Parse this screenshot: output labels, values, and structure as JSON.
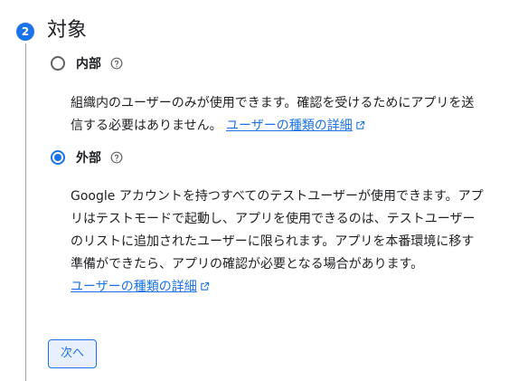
{
  "step": {
    "number": "2",
    "title": "対象"
  },
  "options": [
    {
      "label": "内部",
      "checked": false,
      "description": "組織内のユーザーのみが使用できます。確認を受けるためにアプリを送信する必要はありません。",
      "link_text": "ユーザーの種類の詳細"
    },
    {
      "label": "外部",
      "checked": true,
      "description": "Google アカウントを持つすべてのテストユーザーが使用できます。アプリはテストモードで起動し、アプリを使用できるのは、テストユーザーのリストに追加されたユーザーに限られます。アプリを本番環境に移す準備ができたら、アプリの確認が必要となる場合があります。",
      "link_text": "ユーザーの種類の詳細"
    }
  ],
  "next_button": {
    "label": "次へ"
  },
  "colors": {
    "accent": "#1a73e8",
    "text": "#202124",
    "icon_gray": "#5f6368"
  },
  "icons": {
    "help": "help-circle-icon",
    "external": "open-in-new-icon"
  }
}
